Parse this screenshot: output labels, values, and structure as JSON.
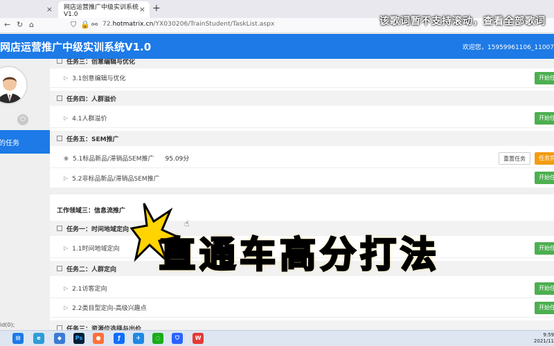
{
  "browser": {
    "tabs": [
      {
        "label": "",
        "active": false
      },
      {
        "label": "网店运营推广中级实训系统V1.0",
        "active": true
      }
    ],
    "url_prefix": "72.",
    "url_host": "hotmatrix.cn",
    "url_path": "/YX030206/TrainStudent/TaskList.aspx"
  },
  "app": {
    "title": "网店运营推广中级实训系统V1.0",
    "welcome": "欢迎您，15959961106_11007"
  },
  "sidebar": {
    "active_item": "我的任务",
    "footer_text": "id(0);"
  },
  "task_sections": [
    {
      "header": "任务三：创意编辑与优化",
      "rows": [
        {
          "label": "3.1创意编辑与优化",
          "score": "",
          "buttons": [
            "开始任务"
          ]
        }
      ]
    },
    {
      "header": "任务四：人群溢价",
      "rows": [
        {
          "label": "4.1人群溢价",
          "score": "",
          "buttons": [
            "开始任务"
          ]
        }
      ]
    },
    {
      "header": "任务五：SEM推广",
      "rows": [
        {
          "label": "5.1标品新品/滞销品SEM推广",
          "score": "95.09分",
          "buttons": [
            "重置任务",
            "任务完成"
          ]
        },
        {
          "label": "5.2非标品新品/滞销品SEM推广",
          "score": "",
          "buttons": [
            "开始任务"
          ]
        }
      ]
    }
  ],
  "work_field": {
    "header": "工作领域三：信息流推广",
    "sections": [
      {
        "header": "任务一：时间地域定向",
        "rows": [
          {
            "label": "1.1时间地域定向",
            "buttons": [
              "开始任务"
            ]
          }
        ]
      },
      {
        "header": "任务二：人群定向",
        "rows": [
          {
            "label": "2.1访客定向",
            "buttons": [
              "开始任务"
            ]
          },
          {
            "label": "2.2类目型定向-高级兴趣点",
            "buttons": [
              "开始任务"
            ]
          }
        ]
      },
      {
        "header": "任务三：资源位选择与出价",
        "rows": []
      }
    ]
  },
  "overlay": {
    "lyric": "该歌词暂不支持滚动，查看全部歌词",
    "caption": "直通车高分打法"
  },
  "taskbar": {
    "time": "9:59",
    "date": "2021/11"
  },
  "colors": {
    "header_blue": "#1d7ae6",
    "green_button": "#4caf50",
    "orange_button": "#f39c12"
  }
}
